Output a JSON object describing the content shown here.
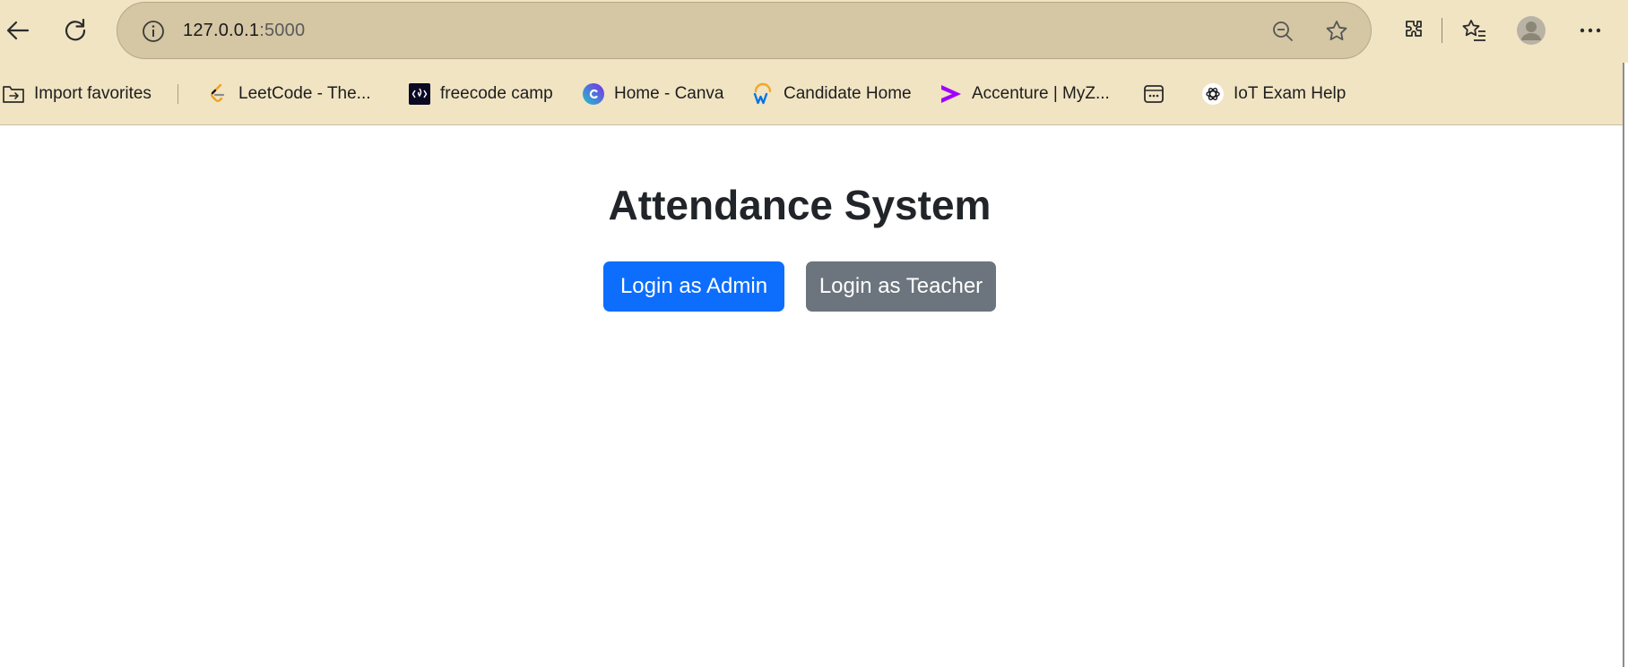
{
  "browser": {
    "address_bar": {
      "host": "127.0.0.1",
      "port": ":5000"
    },
    "bookmarks": [
      {
        "label": "Import favorites",
        "icon": "folder-import-icon"
      },
      {
        "label": "LeetCode - The...",
        "icon": "leetcode-icon"
      },
      {
        "label": "freecode camp",
        "icon": "freecodecamp-icon"
      },
      {
        "label": "Home - Canva",
        "icon": "canva-icon"
      },
      {
        "label": "Candidate Home",
        "icon": "workday-icon"
      },
      {
        "label": "Accenture | MyZ...",
        "icon": "accenture-icon"
      },
      {
        "label": "",
        "icon": "app-window-icon"
      },
      {
        "label": "IoT Exam Help",
        "icon": "openai-icon"
      }
    ],
    "colors": {
      "chrome": "#f1e4c3",
      "address_bar": "#d5c6a4"
    }
  },
  "page": {
    "title": "Attendance System",
    "admin_button": "Login as Admin",
    "teacher_button": "Login as Teacher",
    "colors": {
      "admin": "#0d6efd",
      "teacher": "#6c757d",
      "title": "#212529"
    }
  }
}
